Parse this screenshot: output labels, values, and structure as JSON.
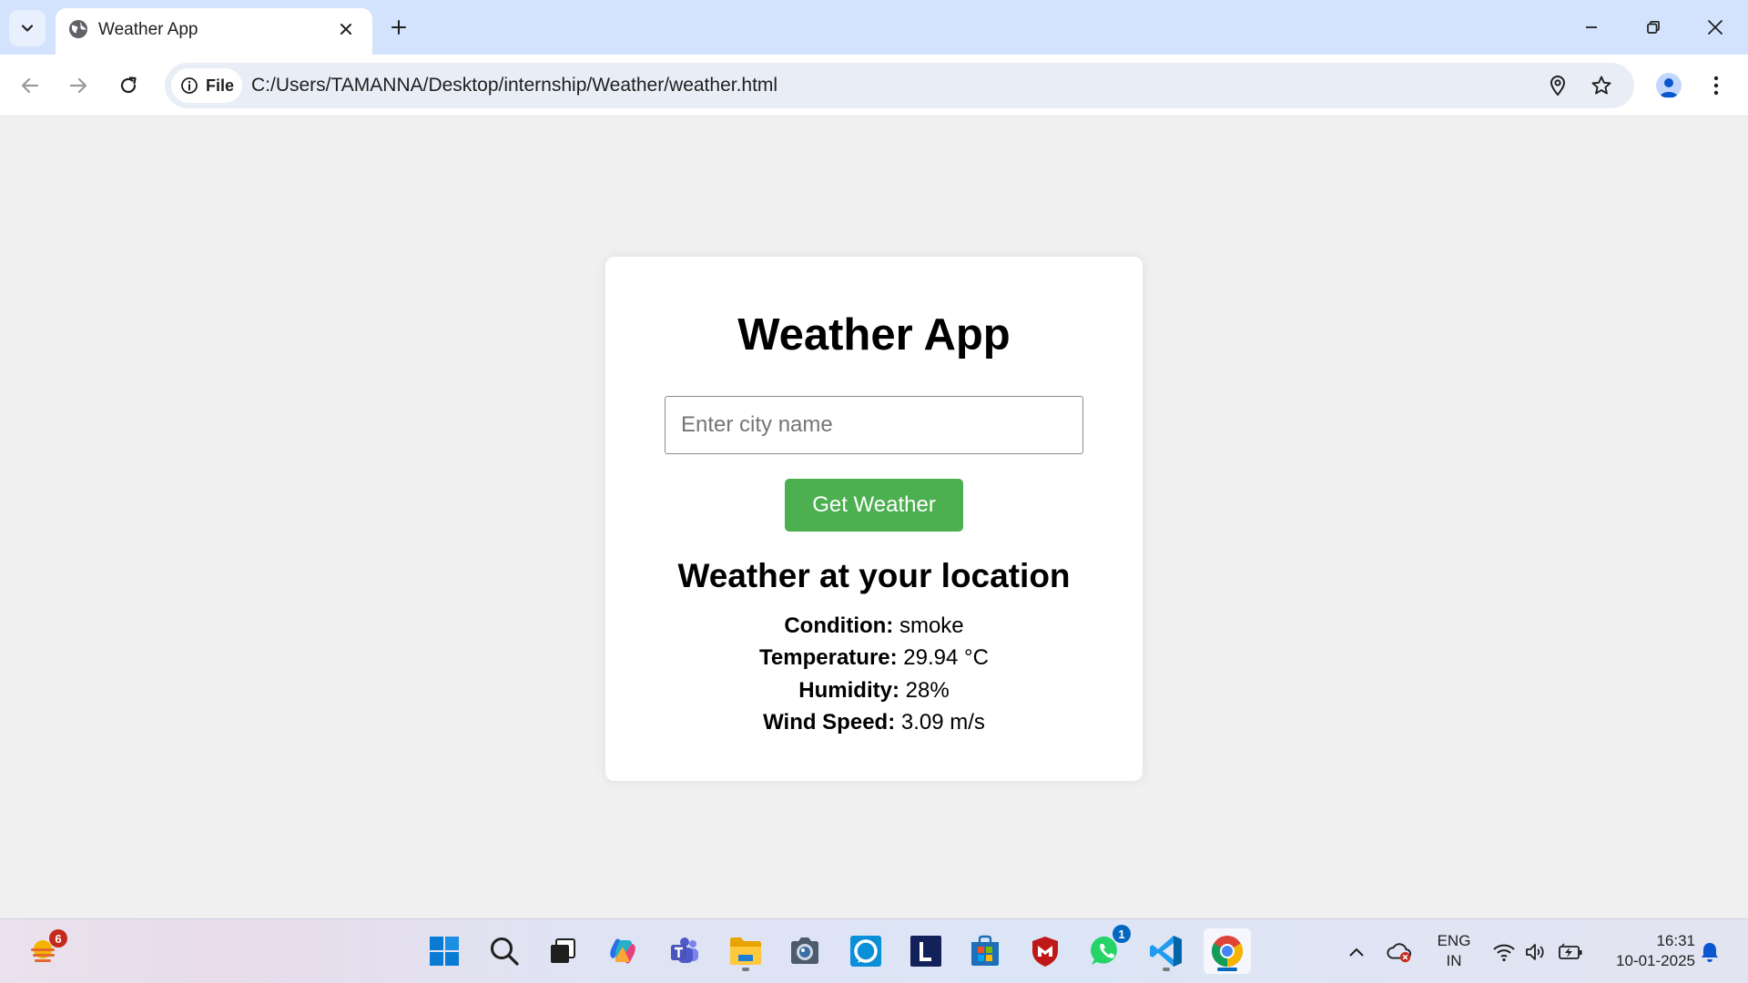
{
  "browser": {
    "tab": {
      "title": "Weather App"
    },
    "site_chip_label": "File",
    "url": "C:/Users/TAMANNA/Desktop/internship/Weather/weather.html"
  },
  "page": {
    "title": "Weather App",
    "search": {
      "placeholder": "Enter city name",
      "value": ""
    },
    "button_label": "Get Weather",
    "result_heading": "Weather at your location",
    "results": [
      {
        "label": "Condition:",
        "value": "smoke"
      },
      {
        "label": "Temperature:",
        "value": "29.94 °C"
      },
      {
        "label": "Humidity:",
        "value": "28%"
      },
      {
        "label": "Wind Speed:",
        "value": "3.09 m/s"
      }
    ],
    "colors": {
      "button": "#4caf50",
      "background": "#f0f0f0",
      "card": "#ffffff"
    }
  },
  "taskbar": {
    "weather_badge": "6",
    "whatsapp_badge": "1",
    "language_line1": "ENG",
    "language_line2": "IN",
    "time": "16:31",
    "date": "10-01-2025"
  }
}
